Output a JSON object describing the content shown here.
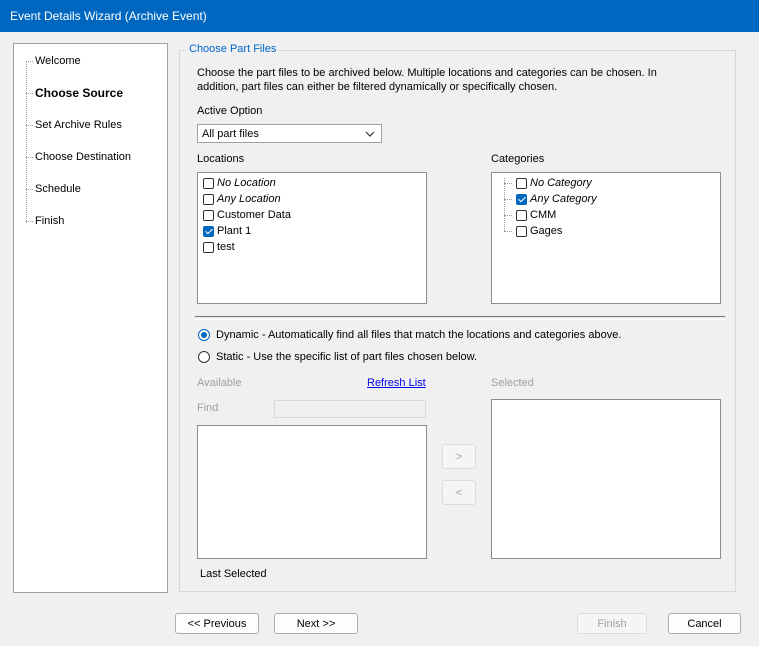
{
  "window": {
    "title": "Event Details Wizard (Archive Event)"
  },
  "nav": {
    "items": [
      {
        "label": "Welcome",
        "active": false
      },
      {
        "label": "Choose Source",
        "active": true
      },
      {
        "label": "Set Archive Rules",
        "active": false
      },
      {
        "label": "Choose Destination",
        "active": false
      },
      {
        "label": "Schedule",
        "active": false
      },
      {
        "label": "Finish",
        "active": false
      }
    ]
  },
  "group": {
    "title": "Choose Part Files",
    "description": "Choose the part files to be archived below. Multiple locations and categories can be chosen. In addition, part files can either be filtered dynamically or specifically chosen."
  },
  "active_option": {
    "label": "Active Option",
    "value": "All part files"
  },
  "locations": {
    "label": "Locations",
    "items": [
      {
        "label": "No Location",
        "checked": false,
        "italic": true
      },
      {
        "label": "Any Location",
        "checked": false,
        "italic": true
      },
      {
        "label": "Customer Data",
        "checked": false,
        "italic": false
      },
      {
        "label": "Plant 1",
        "checked": true,
        "italic": false
      },
      {
        "label": "test",
        "checked": false,
        "italic": false
      }
    ]
  },
  "categories": {
    "label": "Categories",
    "items": [
      {
        "label": "No Category",
        "checked": false,
        "italic": true
      },
      {
        "label": "Any Category",
        "checked": true,
        "italic": true
      },
      {
        "label": "CMM",
        "checked": false,
        "italic": false
      },
      {
        "label": "Gages",
        "checked": false,
        "italic": false
      }
    ]
  },
  "mode": {
    "dynamic": {
      "label": "Dynamic - Automatically find all files that match the locations and categories above.",
      "selected": true
    },
    "static": {
      "label": "Static - Use the specific list of part files chosen below.",
      "selected": false
    }
  },
  "files": {
    "available_label": "Available",
    "refresh_label": "Refresh List",
    "find_label": "Find",
    "selected_label": "Selected",
    "add_label": ">",
    "remove_label": "<",
    "last_selected_label": "Last Selected"
  },
  "footer": {
    "previous_label": "<< Previous",
    "next_label": "Next >>",
    "finish_label": "Finish",
    "cancel_label": "Cancel"
  },
  "colors": {
    "title_bar": "#0067c0",
    "accent": "#0067c0",
    "group_title": "#0066cc",
    "link": "#0000ee"
  }
}
